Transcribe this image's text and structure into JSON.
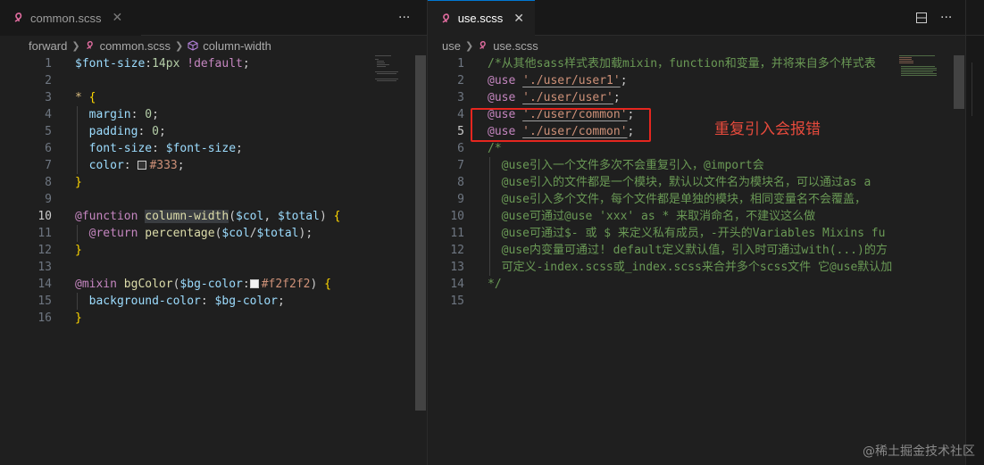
{
  "left": {
    "tab": {
      "label": "common.scss",
      "close": "✕"
    },
    "more_actions": "···",
    "breadcrumb": [
      "forward",
      "common.scss",
      "column-width"
    ],
    "lines": [
      {
        "n": "1",
        "tokens": [
          [
            "$font-size",
            "var"
          ],
          [
            ":",
            "punc"
          ],
          [
            "14px",
            "num"
          ],
          [
            " ",
            "punc"
          ],
          [
            "!default",
            "kw"
          ],
          [
            ";",
            "punc"
          ]
        ]
      },
      {
        "n": "2",
        "tokens": []
      },
      {
        "n": "3",
        "tokens": [
          [
            "*",
            "sel"
          ],
          [
            " ",
            "punc"
          ],
          [
            "{",
            "brace"
          ]
        ]
      },
      {
        "n": "4",
        "tokens": [
          [
            "  margin",
            "prop"
          ],
          [
            ": ",
            "punc"
          ],
          [
            "0",
            "num"
          ],
          [
            ";",
            "punc"
          ]
        ]
      },
      {
        "n": "5",
        "tokens": [
          [
            "  padding",
            "prop"
          ],
          [
            ": ",
            "punc"
          ],
          [
            "0",
            "num"
          ],
          [
            ";",
            "punc"
          ]
        ]
      },
      {
        "n": "6",
        "tokens": [
          [
            "  font-size",
            "prop"
          ],
          [
            ": ",
            "punc"
          ],
          [
            "$font-size",
            "var"
          ],
          [
            ";",
            "punc"
          ]
        ]
      },
      {
        "n": "7",
        "tokens": [
          [
            "  color",
            "prop"
          ],
          [
            ": ",
            "punc"
          ],
          [
            "@swatch:#333333",
            ""
          ],
          [
            "#333",
            "val"
          ],
          [
            ";",
            "punc"
          ]
        ]
      },
      {
        "n": "8",
        "tokens": [
          [
            "}",
            "brace"
          ]
        ]
      },
      {
        "n": "9",
        "tokens": []
      },
      {
        "n": "10",
        "tokens": [
          [
            "@function",
            "kw"
          ],
          [
            " ",
            "punc"
          ],
          [
            "column-width",
            "fnhl"
          ],
          [
            "(",
            "punc"
          ],
          [
            "$col",
            "var"
          ],
          [
            ", ",
            "punc"
          ],
          [
            "$total",
            "var"
          ],
          [
            ")",
            "punc"
          ],
          [
            " ",
            "punc"
          ],
          [
            "{",
            "brace"
          ]
        ]
      },
      {
        "n": "11",
        "tokens": [
          [
            "  @return",
            "kw"
          ],
          [
            " ",
            "punc"
          ],
          [
            "percentage",
            "fn"
          ],
          [
            "(",
            "punc"
          ],
          [
            "$col",
            "var"
          ],
          [
            "/",
            "punc"
          ],
          [
            "$total",
            "var"
          ],
          [
            ");",
            "punc"
          ]
        ]
      },
      {
        "n": "12",
        "tokens": [
          [
            "}",
            "brace"
          ]
        ]
      },
      {
        "n": "13",
        "tokens": []
      },
      {
        "n": "14",
        "tokens": [
          [
            "@mixin",
            "kw"
          ],
          [
            " ",
            "punc"
          ],
          [
            "bgColor",
            "fn"
          ],
          [
            "(",
            "punc"
          ],
          [
            "$bg-color",
            "var"
          ],
          [
            ":",
            "punc"
          ],
          [
            "@swatch:#f2f2f2",
            ""
          ],
          [
            "#f2f2f2",
            "val"
          ],
          [
            ")",
            "punc"
          ],
          [
            " ",
            "punc"
          ],
          [
            "{",
            "brace"
          ]
        ]
      },
      {
        "n": "15",
        "tokens": [
          [
            "  background-color",
            "prop"
          ],
          [
            ": ",
            "punc"
          ],
          [
            "$bg-color",
            "var"
          ],
          [
            ";",
            "punc"
          ]
        ]
      },
      {
        "n": "16",
        "tokens": [
          [
            "}",
            "brace"
          ]
        ]
      }
    ],
    "current_line": "10"
  },
  "right": {
    "tab": {
      "label": "use.scss",
      "close": "✕"
    },
    "breadcrumb": [
      "use",
      "use.scss"
    ],
    "lines": [
      {
        "n": "1",
        "tokens": [
          [
            "/*从其他sass样式表加载mixin，function和变量，并将来自多个样式表",
            "cmt"
          ]
        ]
      },
      {
        "n": "2",
        "tokens": [
          [
            "@use",
            "kw"
          ],
          [
            " ",
            "punc"
          ],
          [
            "'./user/user1'",
            "strul"
          ],
          [
            ";",
            "punc"
          ]
        ]
      },
      {
        "n": "3",
        "tokens": [
          [
            "@use",
            "kw"
          ],
          [
            " ",
            "punc"
          ],
          [
            "'./user/user'",
            "strul"
          ],
          [
            ";",
            "punc"
          ]
        ]
      },
      {
        "n": "4",
        "tokens": [
          [
            "@use",
            "kw"
          ],
          [
            " ",
            "punc"
          ],
          [
            "'./user/common'",
            "strul"
          ],
          [
            ";",
            "punc"
          ]
        ]
      },
      {
        "n": "5",
        "tokens": [
          [
            "@use",
            "kw"
          ],
          [
            " ",
            "punc"
          ],
          [
            "'./user/common'",
            "strul"
          ],
          [
            ";",
            "punc"
          ]
        ]
      },
      {
        "n": "6",
        "tokens": [
          [
            "/*",
            "cmt"
          ]
        ]
      },
      {
        "n": "7",
        "tokens": [
          [
            "  @use引入一个文件多次不会重复引入，@import会",
            "cmt"
          ]
        ]
      },
      {
        "n": "8",
        "tokens": [
          [
            "  @use引入的文件都是一个模块，默认以文件名为模块名，可以通过as a",
            "cmt"
          ]
        ]
      },
      {
        "n": "9",
        "tokens": [
          [
            "  @use引入多个文件，每个文件都是单独的模块，相同变量名不会覆盖，",
            "cmt"
          ]
        ]
      },
      {
        "n": "10",
        "tokens": [
          [
            "  @use可通过@use 'xxx' as * 来取消命名，不建议这么做",
            "cmt"
          ]
        ]
      },
      {
        "n": "11",
        "tokens": [
          [
            "  @use可通过$- 或 $ 来定义私有成员，-开头的Variables Mixins fu",
            "cmt"
          ]
        ]
      },
      {
        "n": "12",
        "tokens": [
          [
            "  @use内变量可通过! default定义默认值，引入时可通过with(...)的方",
            "cmt"
          ]
        ]
      },
      {
        "n": "13",
        "tokens": [
          [
            "  可定义-index.scss或_index.scss来合并多个scss文件 它@use默认加",
            "cmt"
          ]
        ]
      },
      {
        "n": "14",
        "tokens": [
          [
            "*/",
            "cmt"
          ]
        ]
      },
      {
        "n": "15",
        "tokens": []
      }
    ],
    "current_line": "5"
  },
  "annotation": "重复引入会报错",
  "watermark": "@稀土掘金技术社区",
  "colors": {
    "accent": "#0078d4",
    "annotation_red": "#e5261f",
    "scss_icon": "#e06c9f"
  }
}
